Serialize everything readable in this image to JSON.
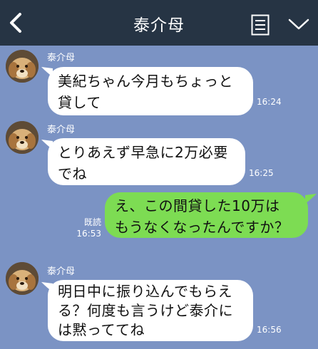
{
  "header": {
    "title": "泰介母"
  },
  "messages": [
    {
      "sender": "泰介母",
      "lines": [
        "美紀ちゃん今月もちょっと",
        "貸して"
      ],
      "time": "16:24"
    },
    {
      "sender": "泰介母",
      "lines": [
        "とりあえず早急に2万必要",
        "でね"
      ],
      "time": "16:25"
    },
    {
      "lines": [
        "え、この間貸した10万は",
        "もうなくなったんですか？"
      ],
      "read": "既読",
      "time": "16:53"
    },
    {
      "sender": "泰介母",
      "lines": [
        "明日中に振り込んでもらえ",
        "る？何度も言うけど泰介に",
        "は黙っててね"
      ],
      "time": "16:56"
    }
  ],
  "colors": {
    "background": "#7b93c4",
    "header": "#263444",
    "incoming": "#ffffff",
    "outgoing": "#7ddc53"
  },
  "icons": [
    "back-arrow-icon",
    "note-icon",
    "chevron-down-icon",
    "avatar-dog"
  ]
}
